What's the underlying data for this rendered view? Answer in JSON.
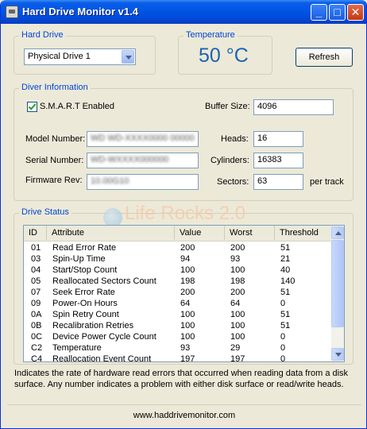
{
  "window": {
    "title": "Hard Drive Monitor v1.4",
    "buttons": {
      "minimize": "_",
      "maximize": "□",
      "close": "✕"
    }
  },
  "hard_drive": {
    "group_label": "Hard Drive",
    "selected": "Physical Drive 1"
  },
  "temperature": {
    "group_label": "Temperature",
    "value": "50 °C"
  },
  "refresh_label": "Refresh",
  "drive_info": {
    "group_label": "Diver Information",
    "smart_label": "S.M.A.R.T Enabled",
    "smart_checked": true,
    "buffer_size_label": "Buffer Size:",
    "buffer_size": "4096",
    "model_label": "Model Number:",
    "model_value": "WD WD-XXXX0000 00000",
    "serial_label": "Serial Number:",
    "serial_value": "WD-WXXXX000000",
    "firmware_label": "Firmware Rev:",
    "firmware_value": "10.00G10",
    "heads_label": "Heads:",
    "heads": "16",
    "cylinders_label": "Cylinders:",
    "cylinders": "16383",
    "sectors_label": "Sectors:",
    "sectors": "63",
    "per_track": "per track"
  },
  "drive_status": {
    "group_label": "Drive Status",
    "watermark": "Life Rocks 2.0",
    "columns": [
      "ID",
      "Attribute",
      "Value",
      "Worst",
      "Threshold"
    ],
    "rows": [
      [
        "01",
        "Read Error Rate",
        "200",
        "200",
        "51"
      ],
      [
        "03",
        "Spin-Up Time",
        "94",
        "93",
        "21"
      ],
      [
        "04",
        "Start/Stop Count",
        "100",
        "100",
        "40"
      ],
      [
        "05",
        "Reallocated Sectors Count",
        "198",
        "198",
        "140"
      ],
      [
        "07",
        "Seek Error Rate",
        "200",
        "200",
        "51"
      ],
      [
        "09",
        "Power-On Hours",
        "64",
        "64",
        "0"
      ],
      [
        "0A",
        "Spin Retry Count",
        "100",
        "100",
        "51"
      ],
      [
        "0B",
        "Recalibration Retries",
        "100",
        "100",
        "51"
      ],
      [
        "0C",
        "Device Power Cycle Count",
        "100",
        "100",
        "0"
      ],
      [
        "C2",
        "Temperature",
        "93",
        "29",
        "0"
      ],
      [
        "C4",
        "Reallocation Event Count",
        "197",
        "197",
        "0"
      ]
    ]
  },
  "description": "Indicates the rate of hardware read errors that occurred when reading data from a disk surface. Any number indicates a problem with either disk surface or read/write heads.",
  "footer": "www.haddrivemonitor.com"
}
